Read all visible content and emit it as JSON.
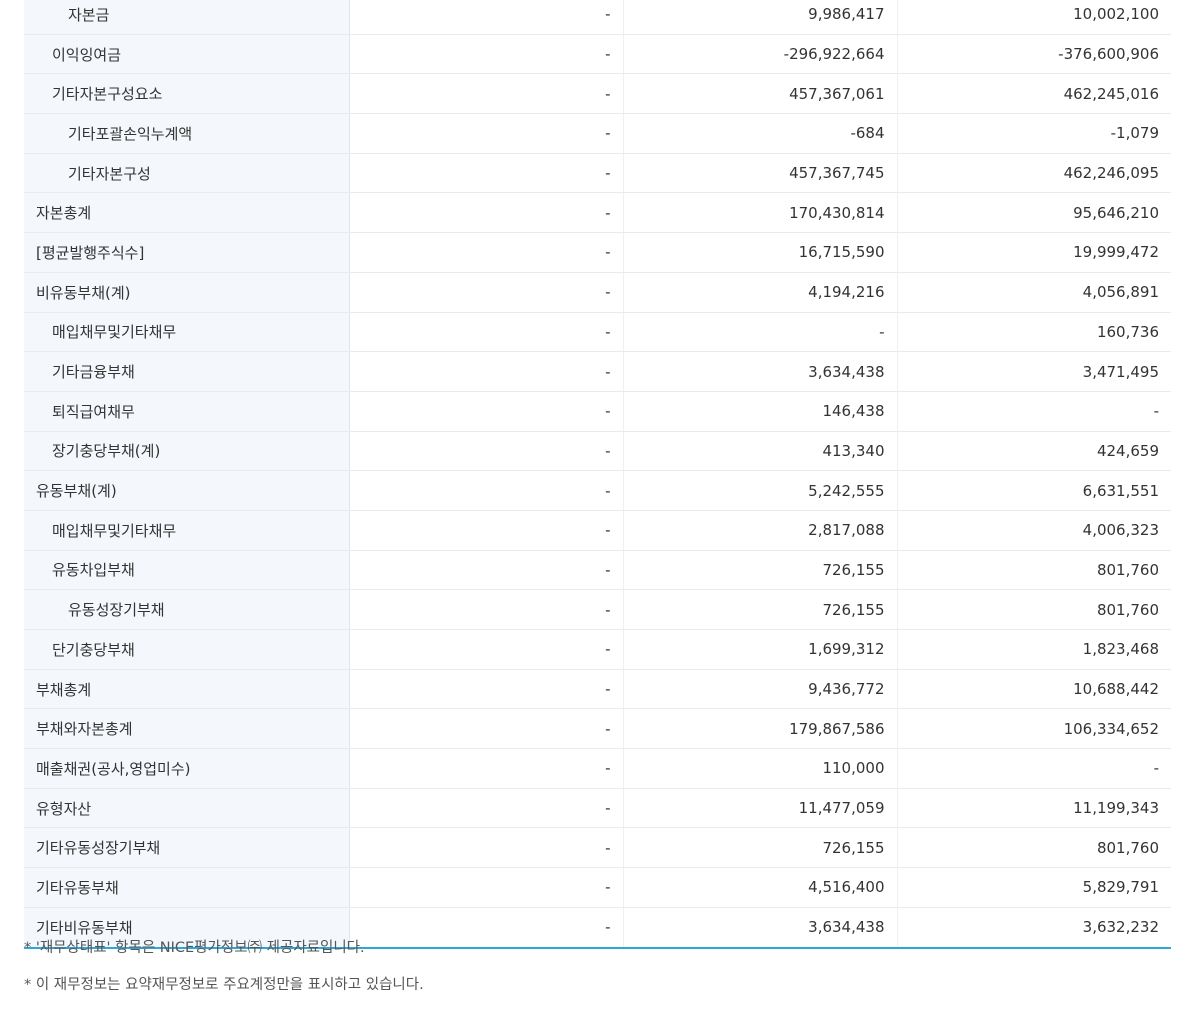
{
  "table": {
    "rows": [
      {
        "label": "자본금",
        "v1": "-",
        "v2": "9,986,417",
        "v3": "10,002,100"
      },
      {
        "label": "이익잉여금",
        "v1": "-",
        "v2": "-296,922,664",
        "v3": "-376,600,906"
      },
      {
        "label": "기타자본구성요소",
        "v1": "-",
        "v2": "457,367,061",
        "v3": "462,245,016"
      },
      {
        "label": "기타포괄손익누계액",
        "v1": "-",
        "v2": "-684",
        "v3": "-1,079"
      },
      {
        "label": "기타자본구성",
        "v1": "-",
        "v2": "457,367,745",
        "v3": "462,246,095"
      },
      {
        "label": "자본총계",
        "v1": "-",
        "v2": "170,430,814",
        "v3": "95,646,210"
      },
      {
        "label": "[평균발행주식수]",
        "v1": "-",
        "v2": "16,715,590",
        "v3": "19,999,472"
      },
      {
        "label": "비유동부채(계)",
        "v1": "-",
        "v2": "4,194,216",
        "v3": "4,056,891"
      },
      {
        "label": "매입채무및기타채무",
        "v1": "-",
        "v2": "-",
        "v3": "160,736"
      },
      {
        "label": "기타금융부채",
        "v1": "-",
        "v2": "3,634,438",
        "v3": "3,471,495"
      },
      {
        "label": "퇴직급여채무",
        "v1": "-",
        "v2": "146,438",
        "v3": "-"
      },
      {
        "label": "장기충당부채(계)",
        "v1": "-",
        "v2": "413,340",
        "v3": "424,659"
      },
      {
        "label": "유동부채(계)",
        "v1": "-",
        "v2": "5,242,555",
        "v3": "6,631,551"
      },
      {
        "label": "매입채무및기타채무",
        "v1": "-",
        "v2": "2,817,088",
        "v3": "4,006,323"
      },
      {
        "label": "유동차입부채",
        "v1": "-",
        "v2": "726,155",
        "v3": "801,760"
      },
      {
        "label": "유동성장기부채",
        "v1": "-",
        "v2": "726,155",
        "v3": "801,760"
      },
      {
        "label": "단기충당부채",
        "v1": "-",
        "v2": "1,699,312",
        "v3": "1,823,468"
      },
      {
        "label": "부채총계",
        "v1": "-",
        "v2": "9,436,772",
        "v3": "10,688,442"
      },
      {
        "label": "부채와자본총계",
        "v1": "-",
        "v2": "179,867,586",
        "v3": "106,334,652"
      },
      {
        "label": "매출채권(공사,영업미수)",
        "v1": "-",
        "v2": "110,000",
        "v3": "-"
      },
      {
        "label": "유형자산",
        "v1": "-",
        "v2": "11,477,059",
        "v3": "11,199,343"
      },
      {
        "label": "기타유동성장기부채",
        "v1": "-",
        "v2": "726,155",
        "v3": "801,760"
      },
      {
        "label": "기타유동부채",
        "v1": "-",
        "v2": "4,516,400",
        "v3": "5,829,791"
      },
      {
        "label": "기타비유동부채",
        "v1": "-",
        "v2": "3,634,438",
        "v3": "3,632,232"
      }
    ]
  },
  "notes": {
    "source": "* '재무상태표' 항목은 NICE평가정보㈜ 제공자료입니다.",
    "summary": "* 이 재무정보는 요약재무정보로 주요계정만을 표시하고 있습니다."
  }
}
